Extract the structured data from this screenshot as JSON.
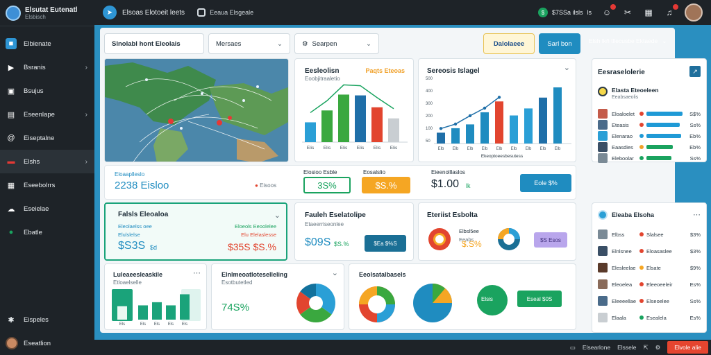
{
  "brand": {
    "title": "Elsutat Eutenatl",
    "subtitle": "Elsbisch"
  },
  "sidebar": {
    "items": [
      {
        "label": "Elbienate",
        "icon": "square-app-icon",
        "color": "#2e95d4"
      },
      {
        "label": "Bsranis",
        "icon": "play-circle-icon",
        "color": "#ffffff",
        "chevron": "›"
      },
      {
        "label": "Bsujus",
        "icon": "monitor-icon",
        "color": "#ffffff"
      },
      {
        "label": "Eseenlape",
        "icon": "briefcase-icon",
        "color": "#ffffff",
        "chevron": "›"
      },
      {
        "label": "Eiseptalne",
        "icon": "at-sign-icon",
        "color": "#ffffff"
      },
      {
        "label": "Elshs",
        "icon": "red-tag-icon",
        "color": "#e53935",
        "chevron": "›",
        "active": true
      },
      {
        "label": "Eseebolrrs",
        "icon": "grid-icon",
        "color": "#ffffff"
      },
      {
        "label": "Eseielae",
        "icon": "cloud-icon",
        "color": "#ffffff"
      },
      {
        "label": "Ebatle",
        "icon": "green-circle-icon",
        "color": "#1aa35f"
      }
    ],
    "bottom": [
      {
        "label": "Eispeles",
        "icon": "puzzle-icon"
      },
      {
        "label": "Eseatlion",
        "icon": "avatar"
      }
    ]
  },
  "topbar": {
    "app_title": "Elsoas Elotoeit leets",
    "crumb": "Eeaua Elsgeale",
    "balance_symbol": "$",
    "balance_value": "$7SSa ilsls",
    "balance_badge": "ls"
  },
  "toolbar": {
    "filter_label": "Slnolabl hont Eleolais",
    "dropdown_label": "Mersaes",
    "search_label": "Searpen",
    "button1": "Dalolaeee",
    "button2": "Sarl bon",
    "right_label": "Elsh lkñ tllecusbe Ektaede"
  },
  "map_card": {},
  "bar_card1": {
    "title": "Eesleolisn",
    "subtitle": "Eoobjitraaletio",
    "legend": "Paqts Eteoas",
    "chart_data": {
      "type": "bar",
      "categories": [
        "Elis",
        "Elis",
        "Elis",
        "Elis",
        "Elis",
        "Elis"
      ],
      "values": [
        25,
        40,
        60,
        59,
        44,
        30
      ]
    }
  },
  "bar_card2": {
    "title": "Sereosis Islagel",
    "xlabel": "Ekeoptoeesbesutess",
    "chart_data": {
      "type": "bar",
      "categories": [
        "Elb",
        "Elb",
        "Elb",
        "Elb",
        "Elb",
        "Elb",
        "Elb",
        "Elb",
        "Elb"
      ],
      "values": [
        17,
        24,
        30,
        49,
        66,
        44,
        55,
        72,
        88
      ],
      "y_ticks": [
        500,
        400,
        300,
        200,
        100,
        50
      ],
      "line": [
        17,
        24,
        37,
        49,
        66
      ]
    }
  },
  "stats": {
    "left_label": "Eloaaplleslo",
    "left_value": "2238 Eisloo",
    "box1_label": "Elosioo Esble",
    "box1_value": "3S%",
    "box2_label": "Eosalslio",
    "box2_value": "$S.%",
    "box3_label": "Eieenolllaslos",
    "box3_value": "$1.00",
    "box3_suffix": "lk",
    "box3_btn": "Eole $%"
  },
  "account_card": {
    "title": "Falsls Eleoaloa",
    "row1a": "Eleolaelss oee",
    "row1b": "Eloeols Eeoolelee",
    "row2a": "Elulslelse",
    "row2b": "Elu Elelaslesse",
    "value_left": "$S3S",
    "value_left_suffix": "$d",
    "value_right": "$35S $S.%"
  },
  "payment_card": {
    "title": "Fauleh Eselatolipe",
    "subtitle": "Etaeerriseonlee",
    "value1": "$09S",
    "value2": "$S.%",
    "btn": "$Ea $%S"
  },
  "market_card": {
    "title": "Eteriist Esbolta",
    "label1": "Elbsl5ee",
    "label2": "Eeabs",
    "value": "$.S%",
    "btn": "$S Esos"
  },
  "income_card": {
    "title": "Luleaeesleaskile",
    "subtitle": "Etloaelselle",
    "chart_data": {
      "type": "bar",
      "categories": [
        "Els",
        "Els",
        "Els",
        "Els",
        "Els"
      ],
      "values": [
        34,
        36,
        44,
        36,
        64
      ]
    }
  },
  "pie_card": {
    "title": "Elnlmeoatloteselleling",
    "subtitle": "Esotbutetled",
    "value": "74S%",
    "chart_data": {
      "type": "pie",
      "values": [
        35,
        30,
        20,
        15
      ],
      "colors": [
        "#2a9fd6",
        "#3aa83f",
        "#e2452f",
        "#12719c"
      ]
    }
  },
  "summary_card": {
    "title": "Eeolsatalbasels",
    "btn1": "Elsis",
    "btn2": "Eseal $0S"
  },
  "right_panel1": {
    "title": "Eesraselolerie",
    "head_title": "Elasta Eteoeleen",
    "head_sub": "Eeabsaeolis",
    "rows": [
      {
        "label": "Eloaloelet",
        "pct": "S$%",
        "color": "#e2452f",
        "bar": "#1f9ad6"
      },
      {
        "label": "Eteasis",
        "pct": "Ss%",
        "color": "#e2452f",
        "bar": "#1f9ad6"
      },
      {
        "label": "Elenarao",
        "pct": "Eb%",
        "color": "#1f9ad6",
        "bar": "#1f9ad6"
      },
      {
        "label": "Eaasdies",
        "pct": "Eb%",
        "color": "#f0a028",
        "bar": "#1aa35f"
      },
      {
        "label": "Eleboolar",
        "pct": "Ss%",
        "color": "#1aa35f",
        "bar": "#1aa35f"
      }
    ]
  },
  "right_panel2": {
    "title": "Eleaba Elsoha",
    "rows": [
      {
        "label": "Elbss",
        "value": "Slalsee",
        "pct": "$3%"
      },
      {
        "label": "Elnlsnee",
        "value": "Eloasaslee",
        "pct": "$3%"
      },
      {
        "label": "Elesleelae",
        "value": "Elsate",
        "pct": "$9%"
      },
      {
        "label": "Eleoelea",
        "value": "Eleeoeeleir",
        "pct": "Es%"
      },
      {
        "label": "Eleeeellae",
        "value": "Elseoelee",
        "pct": "Ss%"
      },
      {
        "label": "Elaala",
        "value": "Esealela",
        "pct": "Es%"
      }
    ]
  },
  "footer": {
    "item1": "Elsearlone",
    "item2": "Elssele",
    "btn": "Elvole alie"
  }
}
